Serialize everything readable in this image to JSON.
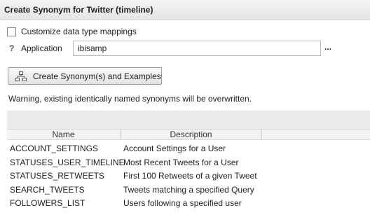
{
  "dialog": {
    "title": "Create Synonym for Twitter (timeline)"
  },
  "options": {
    "customize_label": "Customize data type mappings",
    "customize_checked": false
  },
  "application": {
    "help_glyph": "?",
    "label": "Application",
    "value": "ibisamp",
    "browse_label": "..."
  },
  "create_button": {
    "label": "Create Synonym(s) and Examples",
    "icon": "hierarchy-icon"
  },
  "warning": "Warning, existing identically named synonyms will be overwritten.",
  "table": {
    "columns": [
      "Name",
      "Description"
    ],
    "rows": [
      {
        "name": "ACCOUNT_SETTINGS",
        "description": "Account Settings for a User"
      },
      {
        "name": "STATUSES_USER_TIMELINE",
        "description": "Most Recent Tweets for a User"
      },
      {
        "name": "STATUSES_RETWEETS",
        "description": "First 100 Retweets of a given Tweet"
      },
      {
        "name": "SEARCH_TWEETS",
        "description": "Tweets matching a specified Query"
      },
      {
        "name": "FOLLOWERS_LIST",
        "description": "Users following a specified user"
      }
    ]
  }
}
